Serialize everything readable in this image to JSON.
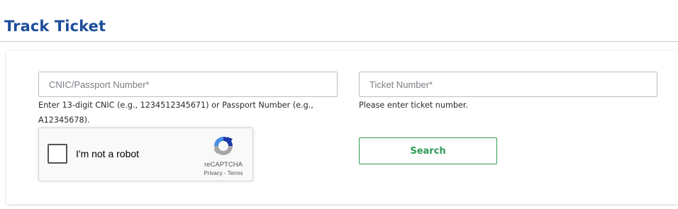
{
  "page": {
    "title": "Track Ticket"
  },
  "form": {
    "cnic": {
      "value": "",
      "placeholder": "CNIC/Passport Number*",
      "hint": "Enter 13-digit CNIC (e.g., 1234512345671) or Passport Number (e.g., A12345678)."
    },
    "ticket": {
      "value": "",
      "placeholder": "Ticket Number*",
      "hint": "Please enter ticket number."
    },
    "search_label": "Search"
  },
  "recaptcha": {
    "label": "I'm not a robot",
    "brand": "reCAPTCHA",
    "privacy": "Privacy",
    "separator": " - ",
    "terms": "Terms",
    "checked": false,
    "logo_icon": "recaptcha-logo-icon"
  },
  "colors": {
    "title": "#1d4e9a",
    "search_accent": "#2e9b57",
    "field_border": "#b9bdc2"
  }
}
